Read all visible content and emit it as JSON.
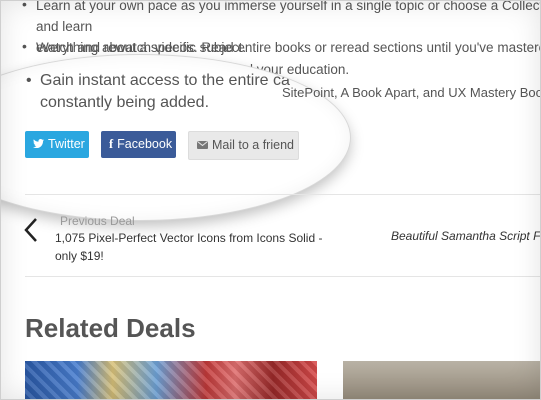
{
  "bullets": [
    "Learn at your own pace as you immerse yourself in a single topic or choose a Collection and learn",
    "everything about a specific subject.",
    "Watch and rewatch videos. Read entire books or reread sections until you've mastered it.",
    "You control your education."
  ],
  "lens": {
    "line1": "Gain instant access to the entire ca",
    "line1_tail": "SitePoint, A Book Apart, and UX Mastery Book",
    "line2": "constantly being added."
  },
  "share": {
    "twitter_label": "Twitter",
    "facebook_label": "Facebook",
    "mail_label": "Mail to a friend",
    "twitter_icon": "twitter-bird",
    "facebook_icon": "f",
    "mail_icon": "envelope"
  },
  "nav": {
    "prev_label": "Previous Deal",
    "prev_title": "1,075 Pixel-Perfect Vector Icons from Icons Solid - only $19!",
    "next_title": "Beautiful Samantha Script Fo"
  },
  "related": {
    "heading": "Related Deals"
  },
  "colors": {
    "twitter": "#2aa7e0",
    "facebook": "#3b5b99"
  }
}
